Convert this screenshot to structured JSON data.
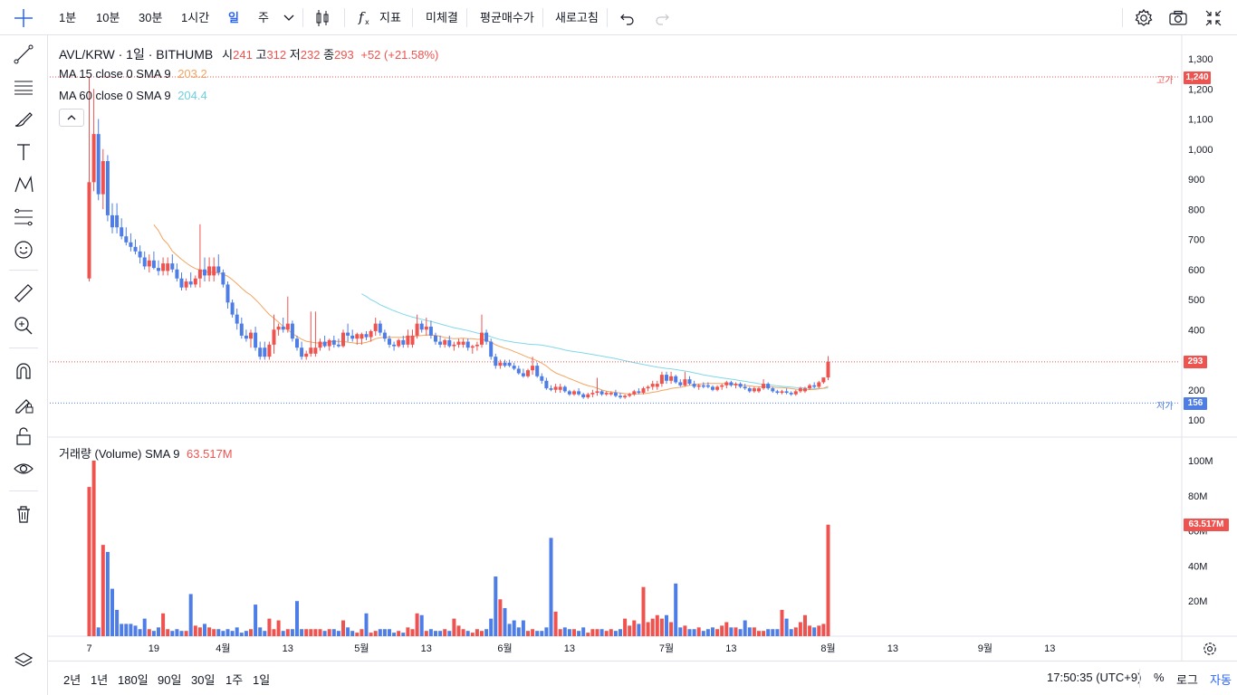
{
  "toolbar": {
    "intervals": [
      "1분",
      "10분",
      "30분",
      "1시간",
      "일",
      "주"
    ],
    "active_interval": "일",
    "indicators_label": "지표",
    "open_orders_label": "미체결",
    "avg_price_label": "평균매수가",
    "refresh_label": "새로고침"
  },
  "legend": {
    "symbol": "AVL/KRW · 1일 · BITHUMB",
    "open_label": "시",
    "open": "241",
    "high_label": "고",
    "high": "312",
    "low_label": "저",
    "low": "232",
    "close_label": "종",
    "close": "293",
    "change": "+52 (+21.58%)",
    "ma15_label": "MA 15 close 0 SMA 9",
    "ma15_value": "203.2",
    "ma60_label": "MA 60 close 0 SMA 9",
    "ma60_value": "204.4",
    "volume_label": "거래량 (Volume) SMA 9",
    "volume_value": "63.517M"
  },
  "price_tags": {
    "high_label": "고가",
    "high_value": "1,240",
    "last_value": "293",
    "low_label": "저가",
    "low_value": "156",
    "volume_value": "63.517M"
  },
  "bottom": {
    "ranges": [
      "2년",
      "1년",
      "180일",
      "90일",
      "30일",
      "1주",
      "1일"
    ],
    "time": "17:50:35 (UTC+9)",
    "percent": "%",
    "log": "로그",
    "auto": "자동"
  },
  "colors": {
    "up": "#ef5350",
    "down": "#4e7de6",
    "ma15": "#f4a460",
    "ma60": "#80d8e8",
    "accent": "#2962ff"
  },
  "chart_data": {
    "type": "candlestick",
    "price_axis": {
      "ticks": [
        "1,300",
        "1,200",
        "1,100",
        "1,000",
        "900",
        "800",
        "700",
        "600",
        "500",
        "400",
        "300",
        "200",
        "100"
      ],
      "ylim": [
        100,
        1300
      ]
    },
    "volume_axis": {
      "ticks": [
        "100M",
        "80M",
        "60M",
        "40M",
        "20M"
      ],
      "ylim": [
        0,
        100000000
      ]
    },
    "x_ticks": [
      "7",
      "19",
      "4월",
      "13",
      "5월",
      "13",
      "6월",
      "13",
      "7월",
      "13",
      "8월",
      "13",
      "9월",
      "13"
    ],
    "high_line": 1240,
    "last_price": 293,
    "low_line": 156,
    "ohlc": [
      [
        570,
        1240,
        560,
        890
      ],
      [
        890,
        1200,
        860,
        1050
      ],
      [
        1050,
        1100,
        830,
        850
      ],
      [
        850,
        1000,
        800,
        960
      ],
      [
        960,
        980,
        760,
        780
      ],
      [
        780,
        820,
        720,
        740
      ],
      [
        740,
        770,
        700,
        710
      ],
      [
        710,
        740,
        680,
        690
      ],
      [
        690,
        720,
        660,
        675
      ],
      [
        675,
        700,
        650,
        660
      ],
      [
        660,
        680,
        620,
        640
      ],
      [
        640,
        660,
        600,
        610
      ],
      [
        610,
        650,
        590,
        630
      ],
      [
        630,
        660,
        600,
        605
      ],
      [
        605,
        630,
        580,
        595
      ],
      [
        595,
        640,
        580,
        620
      ],
      [
        620,
        650,
        590,
        600
      ],
      [
        600,
        620,
        560,
        570
      ],
      [
        570,
        590,
        530,
        540
      ],
      [
        540,
        570,
        530,
        560
      ],
      [
        560,
        590,
        540,
        550
      ],
      [
        550,
        580,
        540,
        570
      ],
      [
        570,
        750,
        540,
        600
      ],
      [
        600,
        640,
        560,
        580
      ],
      [
        580,
        640,
        560,
        610
      ],
      [
        610,
        650,
        580,
        590
      ],
      [
        590,
        600,
        540,
        550
      ],
      [
        550,
        560,
        470,
        490
      ],
      [
        490,
        500,
        440,
        450
      ],
      [
        450,
        470,
        400,
        420
      ],
      [
        420,
        440,
        370,
        380
      ],
      [
        380,
        400,
        360,
        370
      ],
      [
        370,
        400,
        340,
        390
      ],
      [
        390,
        410,
        330,
        340
      ],
      [
        340,
        360,
        300,
        310
      ],
      [
        310,
        360,
        300,
        350
      ],
      [
        350,
        450,
        320,
        400
      ],
      [
        400,
        420,
        380,
        410
      ],
      [
        410,
        440,
        390,
        400
      ],
      [
        400,
        510,
        390,
        420
      ],
      [
        420,
        430,
        360,
        370
      ],
      [
        370,
        380,
        330,
        340
      ],
      [
        340,
        360,
        300,
        310
      ],
      [
        310,
        330,
        300,
        320
      ],
      [
        320,
        460,
        310,
        340
      ],
      [
        340,
        370,
        330,
        360
      ],
      [
        360,
        380,
        340,
        345
      ],
      [
        345,
        370,
        330,
        365
      ],
      [
        365,
        380,
        340,
        350
      ],
      [
        350,
        370,
        340,
        345
      ],
      [
        345,
        400,
        340,
        390
      ],
      [
        390,
        420,
        360,
        380
      ],
      [
        380,
        400,
        360,
        370
      ],
      [
        370,
        390,
        350,
        385
      ],
      [
        385,
        395,
        365,
        375
      ],
      [
        375,
        400,
        360,
        395
      ],
      [
        395,
        440,
        380,
        420
      ],
      [
        420,
        430,
        380,
        390
      ],
      [
        390,
        400,
        360,
        370
      ],
      [
        370,
        380,
        340,
        350
      ],
      [
        350,
        360,
        330,
        345
      ],
      [
        345,
        370,
        340,
        365
      ],
      [
        365,
        380,
        340,
        350
      ],
      [
        350,
        400,
        340,
        380
      ],
      [
        380,
        450,
        370,
        420
      ],
      [
        420,
        430,
        390,
        400
      ],
      [
        400,
        440,
        380,
        410
      ],
      [
        410,
        430,
        370,
        380
      ],
      [
        380,
        390,
        350,
        360
      ],
      [
        360,
        380,
        340,
        350
      ],
      [
        350,
        370,
        340,
        365
      ],
      [
        365,
        380,
        340,
        345
      ],
      [
        345,
        360,
        330,
        350
      ],
      [
        350,
        370,
        340,
        360
      ],
      [
        360,
        370,
        330,
        340
      ],
      [
        340,
        350,
        320,
        345
      ],
      [
        345,
        360,
        330,
        350
      ],
      [
        350,
        450,
        340,
        390
      ],
      [
        390,
        400,
        350,
        360
      ],
      [
        360,
        370,
        300,
        310
      ],
      [
        310,
        320,
        270,
        280
      ],
      [
        280,
        300,
        270,
        290
      ],
      [
        290,
        300,
        275,
        280
      ],
      [
        280,
        290,
        265,
        270
      ],
      [
        270,
        280,
        250,
        255
      ],
      [
        255,
        270,
        240,
        245
      ],
      [
        245,
        270,
        240,
        265
      ],
      [
        265,
        310,
        250,
        280
      ],
      [
        280,
        290,
        240,
        245
      ],
      [
        245,
        255,
        220,
        230
      ],
      [
        230,
        240,
        200,
        205
      ],
      [
        205,
        215,
        195,
        200
      ],
      [
        200,
        220,
        190,
        210
      ],
      [
        210,
        215,
        190,
        195
      ],
      [
        195,
        200,
        180,
        185
      ],
      [
        185,
        200,
        180,
        195
      ],
      [
        195,
        205,
        180,
        185
      ],
      [
        185,
        190,
        170,
        175
      ],
      [
        175,
        190,
        170,
        185
      ],
      [
        185,
        200,
        175,
        190
      ],
      [
        190,
        240,
        180,
        195
      ],
      [
        195,
        200,
        180,
        185
      ],
      [
        185,
        195,
        180,
        190
      ],
      [
        190,
        200,
        175,
        180
      ],
      [
        180,
        190,
        170,
        175
      ],
      [
        175,
        185,
        170,
        180
      ],
      [
        180,
        190,
        175,
        185
      ],
      [
        185,
        200,
        180,
        195
      ],
      [
        195,
        205,
        185,
        190
      ],
      [
        190,
        210,
        185,
        205
      ],
      [
        205,
        215,
        195,
        210
      ],
      [
        210,
        230,
        200,
        220
      ],
      [
        220,
        260,
        210,
        250
      ],
      [
        250,
        260,
        220,
        230
      ],
      [
        230,
        260,
        220,
        245
      ],
      [
        245,
        250,
        220,
        225
      ],
      [
        225,
        235,
        210,
        215
      ],
      [
        215,
        260,
        210,
        235
      ],
      [
        235,
        245,
        215,
        220
      ],
      [
        220,
        230,
        205,
        210
      ],
      [
        210,
        220,
        200,
        215
      ],
      [
        215,
        225,
        205,
        210
      ],
      [
        210,
        215,
        195,
        200
      ],
      [
        200,
        215,
        195,
        210
      ],
      [
        210,
        220,
        200,
        215
      ],
      [
        215,
        230,
        205,
        225
      ],
      [
        225,
        230,
        210,
        215
      ],
      [
        215,
        225,
        205,
        220
      ],
      [
        220,
        225,
        205,
        210
      ],
      [
        210,
        220,
        200,
        205
      ],
      [
        205,
        210,
        190,
        195
      ],
      [
        195,
        210,
        190,
        205
      ],
      [
        205,
        235,
        200,
        220
      ],
      [
        220,
        225,
        200,
        205
      ],
      [
        205,
        210,
        190,
        195
      ],
      [
        195,
        200,
        185,
        190
      ],
      [
        190,
        200,
        185,
        195
      ],
      [
        195,
        205,
        185,
        190
      ],
      [
        190,
        195,
        180,
        185
      ],
      [
        185,
        200,
        180,
        195
      ],
      [
        195,
        210,
        190,
        205
      ],
      [
        205,
        220,
        200,
        215
      ],
      [
        215,
        225,
        205,
        210
      ],
      [
        210,
        230,
        205,
        225
      ],
      [
        225,
        240,
        220,
        241
      ],
      [
        241,
        312,
        232,
        293
      ]
    ],
    "volume_millions": [
      85,
      100,
      5,
      52,
      48,
      27,
      15,
      7,
      7,
      7,
      6,
      4,
      10,
      4,
      3,
      5,
      13,
      4,
      3,
      4,
      3,
      3,
      24,
      6,
      5,
      7,
      5,
      4,
      4,
      3,
      4,
      3,
      5,
      2,
      3,
      4,
      18,
      5,
      3,
      10,
      4,
      9,
      3,
      4,
      4,
      20,
      4,
      4,
      4,
      4,
      4,
      3,
      4,
      4,
      3,
      9,
      5,
      3,
      2,
      4,
      13,
      2,
      3,
      4,
      4,
      4,
      2,
      3,
      2,
      5,
      4,
      13,
      12,
      3,
      4,
      3,
      3,
      4,
      3,
      10,
      6,
      4,
      3,
      2,
      4,
      3,
      4,
      10,
      34,
      21,
      16,
      7,
      9,
      5,
      9,
      3,
      4,
      3,
      3,
      5,
      56,
      14,
      4,
      5,
      4,
      4,
      3,
      5,
      2,
      4,
      4,
      4,
      3,
      4,
      3,
      4,
      10,
      6,
      9,
      7,
      28,
      8,
      10,
      12,
      10,
      12,
      8,
      30,
      5,
      6,
      4,
      4,
      5,
      3,
      4,
      5,
      4,
      6,
      8,
      5,
      5,
      4,
      9,
      5,
      5,
      3,
      3,
      4,
      4,
      4,
      15,
      10,
      4,
      5,
      8,
      12,
      6,
      5,
      6,
      7,
      63.517
    ]
  }
}
